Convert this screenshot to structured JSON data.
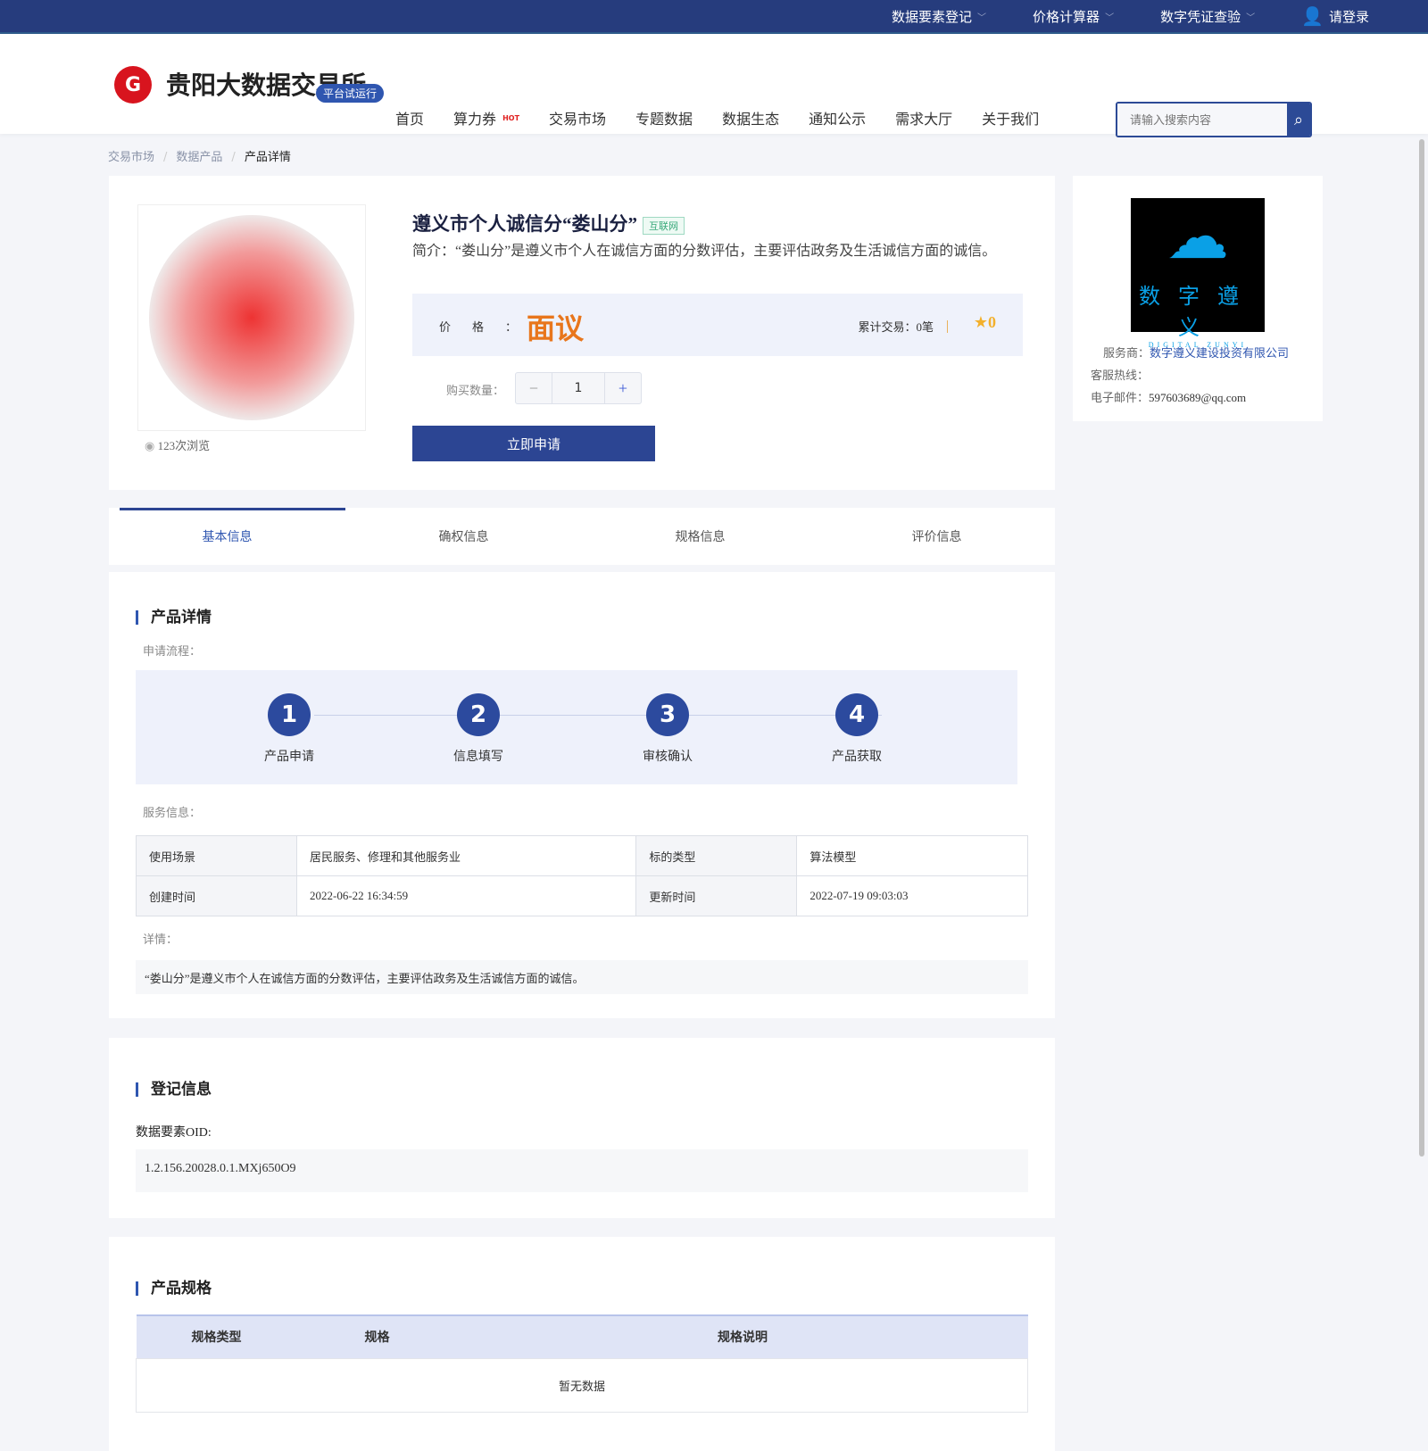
{
  "topbar": {
    "items": [
      "数据要素登记",
      "价格计算器",
      "数字凭证查验"
    ],
    "login": "请登录"
  },
  "header": {
    "brand": "贵阳大数据交易所",
    "trial_badge": "平台试运行",
    "nav": [
      "首页",
      "算力券",
      "交易市场",
      "专题数据",
      "数据生态",
      "通知公示",
      "需求大厅",
      "关于我们"
    ],
    "hot": "HOT",
    "search_placeholder": "请输入搜索内容"
  },
  "breadcrumb": [
    "交易市场",
    "数据产品",
    "产品详情"
  ],
  "product": {
    "title": "遵义市个人诚信分“娄山分”",
    "tag": "互联网",
    "intro": "简介：“娄山分”是遵义市个人在诚信方面的分数评估，主要评估政务及生活诚信方面的诚信。",
    "views": "123次浏览",
    "price_label": "价格：",
    "price": "面议",
    "trades": "累计交易：0笔",
    "rating": "0",
    "qty_label": "购买数量：",
    "qty": "1",
    "apply": "立即申请"
  },
  "provider": {
    "logo_text": "数字遵义",
    "logo_sub": "DIGITAL ZUNYI",
    "provider_label": "服务商：",
    "provider": "数字遵义建设投资有限公司",
    "hotline_label": "客服热线：",
    "email_label": "电子邮件：",
    "email": "597603689@qq.com"
  },
  "tabs": [
    "基本信息",
    "确权信息",
    "规格信息",
    "评价信息"
  ],
  "details": {
    "title": "产品详情",
    "process_label": "申请流程：",
    "steps": [
      {
        "n": "1",
        "label": "产品申请"
      },
      {
        "n": "2",
        "label": "信息填写"
      },
      {
        "n": "3",
        "label": "审核确认"
      },
      {
        "n": "4",
        "label": "产品获取"
      }
    ],
    "service_label": "服务信息：",
    "rows": [
      [
        "使用场景",
        "居民服务、修理和其他服务业",
        "标的类型",
        "算法模型"
      ],
      [
        "创建时间",
        "2022-06-22 16:34:59",
        "更新时间",
        "2022-07-19 09:03:03"
      ]
    ],
    "detail_label": "详情：",
    "detail_text": "“娄山分”是遵义市个人在诚信方面的分数评估，主要评估政务及生活诚信方面的诚信。"
  },
  "registration": {
    "title": "登记信息",
    "oid_label": "数据要素OID:",
    "oid": "1.2.156.20028.0.1.MXj650O9"
  },
  "spec": {
    "title": "产品规格",
    "headers": [
      "规格类型",
      "规格",
      "规格说明"
    ],
    "empty": "暂无数据"
  }
}
